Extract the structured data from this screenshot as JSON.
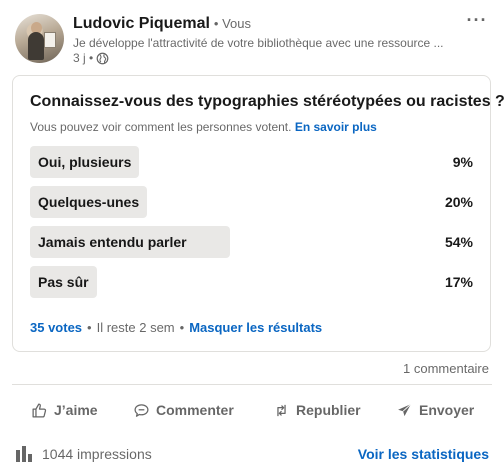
{
  "post": {
    "author_name": "Ludovic Piquemal",
    "author_meta": "• Vous",
    "headline": "Je développe l'attractivité de votre bibliothèque avec une ressource ...",
    "time": "3 j •",
    "more_label": "···"
  },
  "poll": {
    "question": "Connaissez-vous des typographies stéréotypées ou racistes ?",
    "visibility_note": "Vous pouvez voir comment les personnes votent.",
    "learn_more": "En savoir plus",
    "options": [
      {
        "label": "Oui, plusieurs",
        "percent_label": "9%",
        "percent": 9
      },
      {
        "label": "Quelques-unes",
        "percent_label": "20%",
        "percent": 20
      },
      {
        "label": "Jamais entendu parler",
        "percent_label": "54%",
        "percent": 54
      },
      {
        "label": "Pas sûr",
        "percent_label": "17%",
        "percent": 17
      }
    ],
    "votes": "35 votes",
    "remaining": "Il reste 2 sem",
    "hide_results": "Masquer les résultats",
    "separator": "•"
  },
  "social": {
    "comments": "1 commentaire"
  },
  "actions": {
    "like": "J’aime",
    "comment": "Commenter",
    "repost": "Republier",
    "send": "Envoyer"
  },
  "stats": {
    "impressions": "1044 impressions",
    "see_stats": "Voir les statistiques"
  },
  "colors": {
    "link": "#0a66c2",
    "bar": "#e9e8e6",
    "muted": "#666666"
  },
  "icons": {
    "visibility": "globe-icon",
    "like": "thumbs-up-icon",
    "comment": "comment-bubble-icon",
    "repost": "repost-arrows-icon",
    "send": "paper-plane-icon",
    "impressions": "bar-chart-icon",
    "more": "ellipsis-icon"
  }
}
